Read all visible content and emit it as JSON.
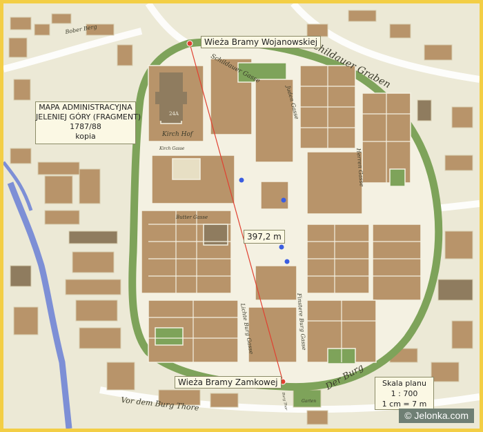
{
  "map": {
    "title_lines": [
      "MAPA ADMINISTRACYJNA",
      "JELENIEJ GÓRY (FRAGMENT)",
      "1787/88",
      "kopia"
    ],
    "tower_north": "Wieża Bramy Wojanowskiej",
    "tower_south": "Wieża Bramy Zamkowej",
    "distance": "397,2 m",
    "scale_lines": [
      "Skala planu",
      "1 : 700",
      "1 cm = 7 m"
    ],
    "credit": "© Jelonka.com",
    "street_labels": {
      "bober_berg": "Bober Berg",
      "schildauer_gasse": "Schildauer Gasse",
      "juden_gasse": "Juden Gasse",
      "kirch_hof": "Kirch Hof",
      "kirch_gasse": "Kirch Gasse",
      "butter_gasse": "Butter Gasse",
      "lichte_burg_gasse": "Lichte Burg Gasse",
      "finstere_burg_gasse": "Finstere Burg Gasse",
      "herren_gasse": "Herren Gasse",
      "schildauer_graben": "Schildauer Graben",
      "der_burg": "Der Burg",
      "vor_dem_burg_thore": "Vor dem Burg Thore",
      "garten": "Garten",
      "burg_thor": "Burg Thor"
    },
    "colors": {
      "background": "#ece9d6",
      "building": "#b8946a",
      "building_dark": "#8f7c5f",
      "wall_green": "#7ea35a",
      "river": "#7d8fd6",
      "line": "#e04030",
      "marker": "#3a5de0",
      "frame": "#f3ce45"
    }
  }
}
